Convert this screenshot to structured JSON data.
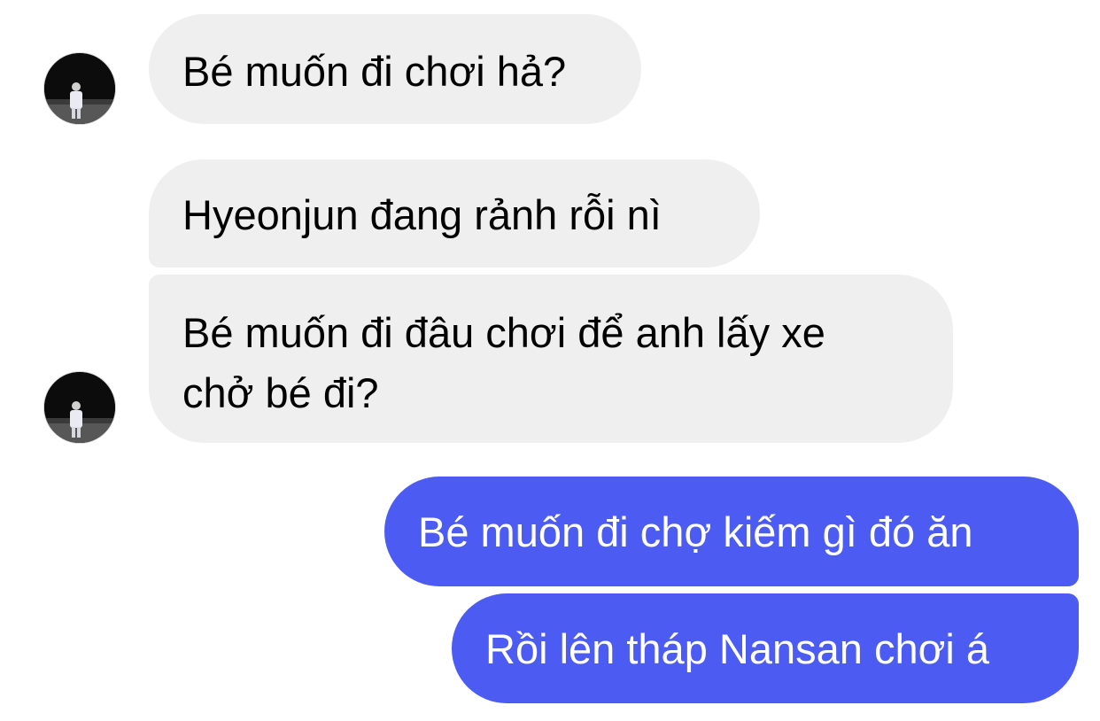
{
  "messages": [
    {
      "sender": "them",
      "text": "Bé muốn đi chơi hả?"
    },
    {
      "sender": "them",
      "text": "Hyeonjun đang rảnh rỗi nì"
    },
    {
      "sender": "them",
      "text": "Bé muốn đi đâu chơi để anh lấy xe\nchở bé đi?"
    },
    {
      "sender": "me",
      "text": "Bé muốn đi chợ kiếm gì đó ăn"
    },
    {
      "sender": "me",
      "text": "Rồi lên tháp Nansan chơi á"
    }
  ],
  "colors": {
    "incoming_bubble": "#efefef",
    "outgoing_bubble": "#4c5cf3",
    "incoming_text": "#000000",
    "outgoing_text": "#ffffff"
  }
}
